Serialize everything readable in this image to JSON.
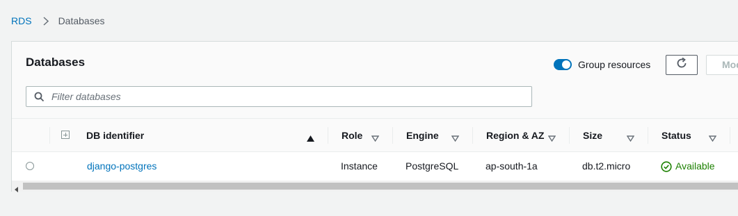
{
  "breadcrumb": {
    "root": "RDS",
    "current": "Databases"
  },
  "panel": {
    "title": "Databases",
    "group_toggle_label": "Group resources",
    "group_toggle_on": true,
    "modify_label": "Modify",
    "filter_placeholder": "Filter databases"
  },
  "table": {
    "columns": [
      {
        "key": "db_identifier",
        "label": "DB identifier",
        "sort": "ascending"
      },
      {
        "key": "role",
        "label": "Role"
      },
      {
        "key": "engine",
        "label": "Engine"
      },
      {
        "key": "region_az",
        "label": "Region & AZ"
      },
      {
        "key": "size",
        "label": "Size"
      },
      {
        "key": "status",
        "label": "Status"
      }
    ],
    "rows": [
      {
        "db_identifier": "django-postgres",
        "role": "Instance",
        "engine": "PostgreSQL",
        "region_az": "ap-south-1a",
        "size": "db.t2.micro",
        "status": "Available"
      }
    ]
  },
  "colors": {
    "link": "#0073bb",
    "status_available": "#1d8102",
    "toggle_on": "#0073bb"
  },
  "icons": [
    "chevron-right-icon",
    "refresh-icon",
    "search-icon",
    "sort-ascending-icon",
    "sort-icon",
    "expand-icon",
    "check-circle-icon",
    "scroll-left-icon"
  ]
}
